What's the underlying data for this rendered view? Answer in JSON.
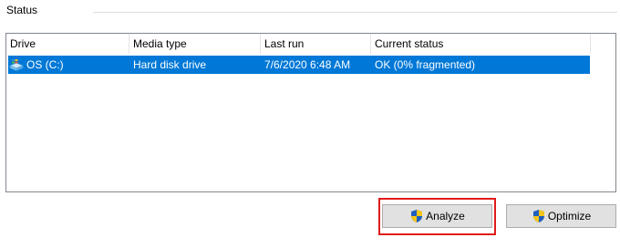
{
  "status": {
    "label": "Status"
  },
  "columns": [
    "Drive",
    "Media type",
    "Last run",
    "Current status"
  ],
  "drives": [
    {
      "name": "OS (C:)",
      "media_type": "Hard disk drive",
      "last_run": "7/6/2020 6:48 AM",
      "current_status": "OK (0% fragmented)",
      "icon": "hard-drive-icon",
      "selected": true
    }
  ],
  "buttons": {
    "analyze": {
      "label": "Analyze",
      "icon": "uac-shield-icon",
      "highlighted": true
    },
    "optimize": {
      "label": "Optimize",
      "icon": "uac-shield-icon"
    }
  },
  "colors": {
    "selection": "#0078d7",
    "highlight_box": "#e01b1b",
    "button_face": "#e1e1e1"
  }
}
